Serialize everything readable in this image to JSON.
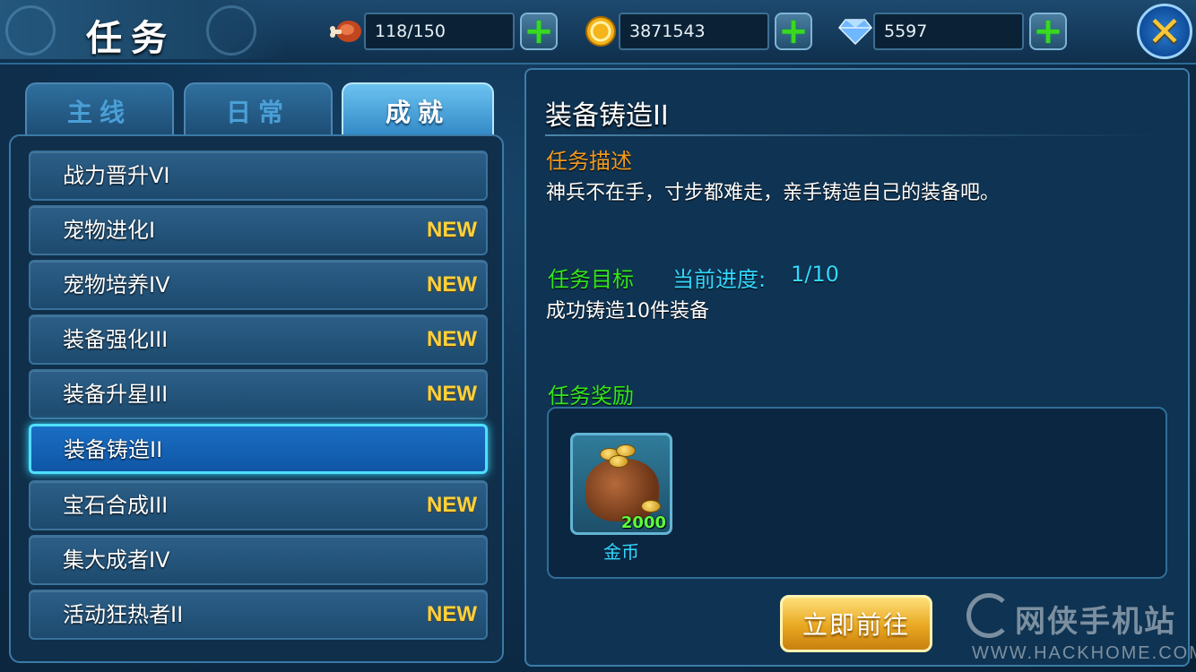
{
  "header": {
    "title": "任务",
    "resources": [
      {
        "icon": "meat-icon",
        "value": "118/150"
      },
      {
        "icon": "gold-coin-icon",
        "value": "3871543"
      },
      {
        "icon": "diamond-icon",
        "value": "5597"
      }
    ],
    "plus_glyph": "+",
    "close_glyph": "✕"
  },
  "tabs": [
    {
      "label": "主线",
      "active": false
    },
    {
      "label": "日常",
      "active": false
    },
    {
      "label": "成就",
      "active": true
    }
  ],
  "quests": [
    {
      "name": "战力晋升VI",
      "badge": ""
    },
    {
      "name": "宠物进化I",
      "badge": "NEW"
    },
    {
      "name": "宠物培养IV",
      "badge": "NEW"
    },
    {
      "name": "装备强化III",
      "badge": "NEW"
    },
    {
      "name": "装备升星III",
      "badge": "NEW"
    },
    {
      "name": "装备铸造II",
      "badge": "",
      "selected": true
    },
    {
      "name": "宝石合成III",
      "badge": "NEW"
    },
    {
      "name": "集大成者IV",
      "badge": ""
    },
    {
      "name": "活动狂热者II",
      "badge": "NEW"
    }
  ],
  "detail": {
    "title": "装备铸造II",
    "desc_heading": "任务描述",
    "desc_text": "神兵不在手，寸步都难走，亲手铸造自己的装备吧。",
    "goal_heading": "任务目标",
    "progress_label": "当前进度:",
    "progress_value": "1/10",
    "goal_text": "成功铸造10件装备",
    "reward_heading": "任务奖励",
    "reward": {
      "name": "金币",
      "quantity": "2000",
      "icon": "gold-bag-icon"
    },
    "go_button": "立即前往"
  },
  "watermark": {
    "text": "网侠手机站",
    "url": "WWW.HACKHOME.COM"
  },
  "colors": {
    "accent_orange": "#f09a1e",
    "accent_green": "#33e61a",
    "accent_cyan": "#33d8ff",
    "badge_new": "#ffd23a"
  }
}
